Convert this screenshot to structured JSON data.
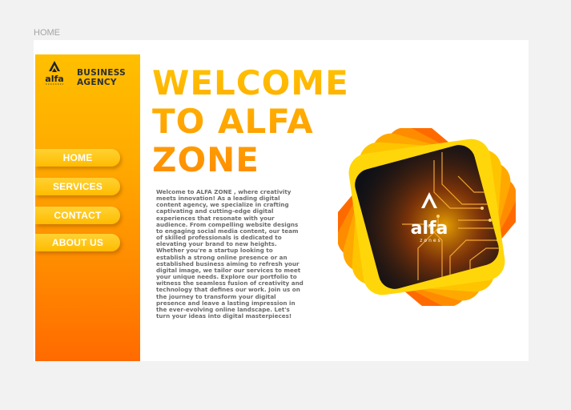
{
  "frame_label": "HOME",
  "brand": {
    "logo_text": "alfa",
    "line1": "BUSINESS",
    "line2": "AGENCY"
  },
  "nav": [
    {
      "label": "HOME"
    },
    {
      "label": "SERVICES"
    },
    {
      "label": "CONTACT"
    },
    {
      "label": "ABOUT US"
    }
  ],
  "hero": {
    "line1": "WELCOME",
    "line2": "TO ALFA",
    "line3": "ZONE",
    "body": "Welcome to ALFA ZONE , where creativity meets innovation! As a leading digital content agency, we specialize in crafting captivating and cutting-edge digital experiences that resonate with your audience. From compelling website designs to engaging social media content, our team of skilled professionals is dedicated to elevating your brand to new heights. Whether you're a startup looking to establish a strong online presence or an established business aiming to refresh your digital image, we tailor our services to meet your unique needs. Explore our portfolio to witness the seamless fusion of creativity and technology that defines our work. Join us on the journey to transform your digital presence and leave a lasting impression in the ever-evolving online landscape. Let's turn your ideas into digital masterpieces!"
  },
  "art": {
    "logo_text": "alfa",
    "logo_sub": "zones"
  },
  "colors": {
    "accent_top": "#ffbf00",
    "accent_bottom": "#ff6a00",
    "brand_text": "#2b2f36"
  },
  "icons": [
    "alfa-logo-icon",
    "circuit-art-image"
  ]
}
